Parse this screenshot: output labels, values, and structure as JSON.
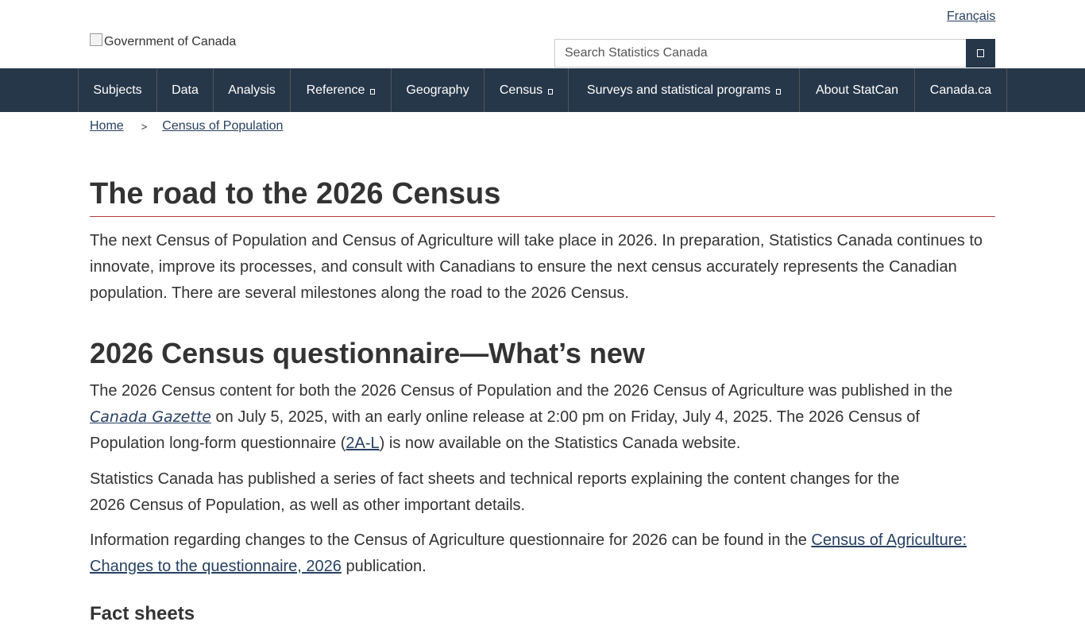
{
  "header": {
    "language_link": "Français",
    "gov_logo_alt": "Government of Canada",
    "search_placeholder": "Search Statistics Canada"
  },
  "nav": {
    "items": [
      {
        "label": "Subjects"
      },
      {
        "label": "Data"
      },
      {
        "label": "Analysis"
      },
      {
        "label": "Reference"
      },
      {
        "label": "Geography"
      },
      {
        "label": "Census"
      },
      {
        "label": "Surveys and statistical programs"
      },
      {
        "label": "About StatCan"
      },
      {
        "label": "Canada.ca"
      }
    ]
  },
  "breadcrumb": {
    "home": "Home",
    "separator": ">",
    "current": "Census of Population"
  },
  "main": {
    "title": "The road to the 2026 Census",
    "intro": "The next Census of Population and Census of Agriculture will take place in 2026. In preparation, Statistics Canada continues to innovate, improve its processes, and consult with Canadians to ensure the next census accurately represents the Canadian population. There are several milestones along the road to the 2026 Census.",
    "section_title": "2026 Census questionnaire—What’s new",
    "p1_before": "The 2026 Census content for both the 2026 Census of Population and the 2026 Census of Agriculture was published in the ",
    "p1_link": "Canada Gazette",
    "p1_middle": " on July 5, 2025, with an early online release at 2:00 pm on Friday, July 4, 2025. The 2026 Census of Population long-form questionnaire (",
    "p1_link2": "2A-L",
    "p1_after": ") is now available on the Statistics Canada website.",
    "p2_line1": "Statistics Canada has published a series of fact sheets and technical reports explaining the content changes for the",
    "p2_line2": "2026 Census of Population, as well as other important details.",
    "p3_before": "Information regarding changes to the Census of Agriculture questionnaire for 2026 can be found in the ",
    "p3_link_line1": "Census of Agriculture:",
    "p3_link_line2": "Changes to the questionnaire, 2026",
    "p3_after": " publication.",
    "next_heading": "Fact sheets"
  }
}
